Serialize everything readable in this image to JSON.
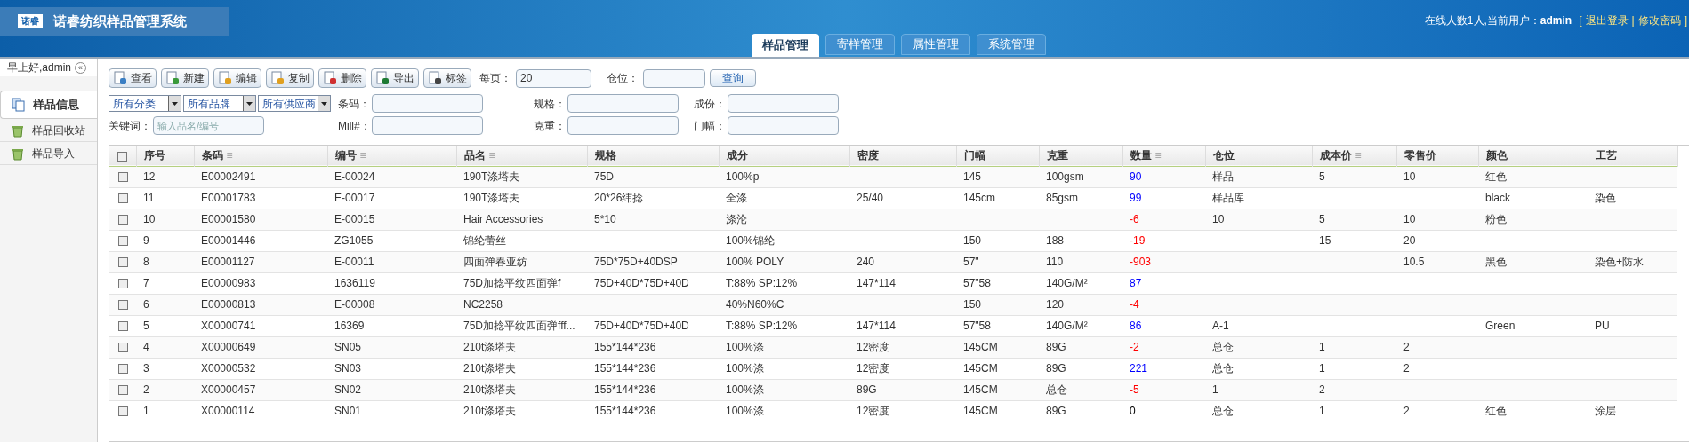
{
  "header": {
    "logo_text": "诺睿",
    "title": "诺睿纺织样品管理系统",
    "online": "在线人数1人,当前用户：",
    "user": "admin",
    "logout": "退出登录",
    "change_password": "修改密码",
    "bracket_open": "[",
    "separator": "|",
    "bracket_close": "]"
  },
  "tabs": [
    {
      "label": "样品管理",
      "selected": true
    },
    {
      "label": "寄样管理",
      "selected": false
    },
    {
      "label": "属性管理",
      "selected": false
    },
    {
      "label": "系统管理",
      "selected": false
    }
  ],
  "sidebar": {
    "greeting": "早上好,admin",
    "collapse": "«",
    "items": [
      {
        "label": "样品信息",
        "selected": true,
        "kind": "pages"
      },
      {
        "label": "样品回收站",
        "selected": false,
        "kind": "recycle"
      },
      {
        "label": "样品导入",
        "selected": false,
        "kind": "recycle"
      }
    ]
  },
  "toolbar": {
    "buttons": [
      {
        "label": "查看",
        "kind": "view"
      },
      {
        "label": "新建",
        "kind": "new"
      },
      {
        "label": "编辑",
        "kind": "edit"
      },
      {
        "label": "复制",
        "kind": "edit"
      },
      {
        "label": "删除",
        "kind": "delete"
      },
      {
        "label": "导出",
        "kind": "excel"
      },
      {
        "label": "标签",
        "kind": "print"
      }
    ],
    "per_page_label": "每页：",
    "per_page_value": "20",
    "location_label": "仓位：",
    "query_button": "查询"
  },
  "filters": {
    "selects": [
      "所有分类",
      "所有品牌",
      "所有供应商"
    ],
    "fields": [
      {
        "label": "条码："
      },
      {
        "label": "规格："
      },
      {
        "label": "成份："
      },
      {
        "label": "Mill#："
      },
      {
        "label": "克重："
      },
      {
        "label": "门幅："
      }
    ],
    "keyword_label": "关键词：",
    "keyword_placeholder": "输入品名/编号"
  },
  "table": {
    "select_all_checked": false,
    "columns": [
      {
        "label": "序号"
      },
      {
        "label": "条码",
        "sort_icon": "≡"
      },
      {
        "label": "编号",
        "sort_icon": "≡"
      },
      {
        "label": "品名",
        "sort_icon": "≡"
      },
      {
        "label": "规格"
      },
      {
        "label": "成分"
      },
      {
        "label": "密度"
      },
      {
        "label": "门幅"
      },
      {
        "label": "克重"
      },
      {
        "label": "数量",
        "sort_icon": "≡"
      },
      {
        "label": "仓位"
      },
      {
        "label": "成本价",
        "sort_icon": "≡"
      },
      {
        "label": "零售价"
      },
      {
        "label": "颜色"
      },
      {
        "label": "工艺"
      }
    ],
    "rows": [
      {
        "checked": false,
        "cells": [
          "12",
          "E00002491",
          "E-00024",
          "190T涤塔夫",
          "75D",
          "100%p",
          "",
          "145",
          "100gsm",
          "90",
          "样品",
          "5",
          "10",
          "红色",
          ""
        ],
        "color": "#0000ff"
      },
      {
        "checked": false,
        "cells": [
          "11",
          "E00001783",
          "E-00017",
          "190T涤塔夫",
          "20*26纬捻",
          "全涤",
          "25/40",
          "145cm",
          "85gsm",
          "99",
          "样品库",
          "",
          "",
          "black",
          "染色"
        ],
        "color": "#0000ff"
      },
      {
        "checked": false,
        "cells": [
          "10",
          "E00001580",
          "E-00015",
          "Hair Accessories",
          "5*10",
          "涤沦",
          "",
          "",
          "",
          "-6",
          "10",
          "5",
          "10",
          "粉色",
          ""
        ],
        "color": "#ff0000"
      },
      {
        "checked": false,
        "cells": [
          "9",
          "E00001446",
          "ZG1055",
          "锦纶蕾丝",
          "",
          "100%锦纶",
          "",
          "150",
          "188",
          "-19",
          "",
          "15",
          "20",
          "",
          ""
        ],
        "color": "#ff0000"
      },
      {
        "checked": false,
        "cells": [
          "8",
          "E00001127",
          "E-00011",
          "四面弹春亚纺",
          "75D*75D+40DSP",
          "100% POLY",
          "240",
          "57\"",
          "110",
          "-903",
          "",
          "",
          "10.5",
          "黑色",
          "染色+防水"
        ],
        "color": "#ff0000"
      },
      {
        "checked": false,
        "cells": [
          "7",
          "E00000983",
          "1636119",
          "75D加捻平纹四面弹f",
          "75D+40D*75D+40D",
          "T:88% SP:12%",
          "147*114",
          "57\"58",
          "140G/M²",
          "87",
          "",
          "",
          "",
          "",
          ""
        ],
        "color": "#0000ff"
      },
      {
        "checked": false,
        "cells": [
          "6",
          "E00000813",
          "E-00008",
          "NC2258",
          "",
          "40%N60%C",
          "",
          "150",
          "120",
          "-4",
          "",
          "",
          "",
          "",
          ""
        ],
        "color": "#ff0000"
      },
      {
        "checked": false,
        "cells": [
          "5",
          "X00000741",
          "16369",
          "75D加捻平纹四面弹fff...",
          "75D+40D*75D+40D",
          "T:88% SP:12%",
          "147*114",
          "57\"58",
          "140G/M²",
          "86",
          "A-1",
          "",
          "",
          "Green",
          "PU"
        ],
        "color": "#0000ff"
      },
      {
        "checked": false,
        "cells": [
          "4",
          "X00000649",
          "SN05",
          "210t涤塔夫",
          "155*144*236",
          "100%涤",
          "12密度",
          "145CM",
          "89G",
          "-2",
          "总仓",
          "1",
          "2",
          "",
          ""
        ],
        "color": "#ff0000"
      },
      {
        "checked": false,
        "cells": [
          "3",
          "X00000532",
          "SN03",
          "210t涤塔夫",
          "155*144*236",
          "100%涤",
          "12密度",
          "145CM",
          "89G",
          "221",
          "总仓",
          "1",
          "2",
          "",
          ""
        ],
        "color": "#0000ff"
      },
      {
        "checked": false,
        "cells": [
          "2",
          "X00000457",
          "SN02",
          "210t涤塔夫",
          "155*144*236",
          "100%涤",
          "89G",
          "145CM",
          "总仓",
          "-5",
          "1",
          "2",
          "",
          "",
          ""
        ],
        "color": "#ff0000"
      },
      {
        "checked": false,
        "cells": [
          "1",
          "X00000114",
          "SN01",
          "210t涤塔夫",
          "155*144*236",
          "100%涤",
          "12密度",
          "145CM",
          "89G",
          "0",
          "总仓",
          "1",
          "2",
          "红色",
          "涂层"
        ]
      }
    ]
  }
}
